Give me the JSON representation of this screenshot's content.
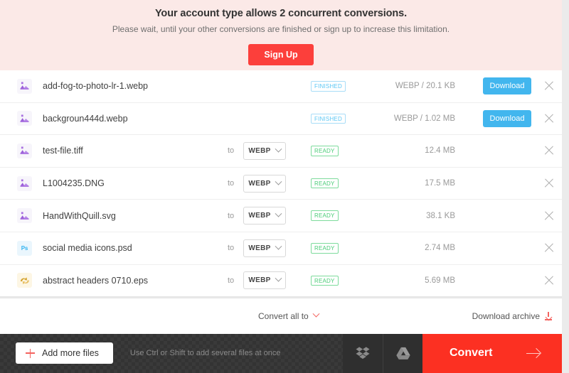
{
  "banner": {
    "title": "Your account type allows 2 concurrent conversions.",
    "subtitle": "Please wait, until your other conversions are finished or sign up to increase this limitation.",
    "signup_label": "Sign Up",
    "background_color": "#fbe9e7",
    "signup_color": "#fc3f3b"
  },
  "files": [
    {
      "name": "add-fog-to-photo-lr-1.webp",
      "icon": "image-file-icon",
      "to_label": "",
      "format": "",
      "status": "FINISHED",
      "status_type": "finished",
      "size": "WEBP / 20.1 KB",
      "download_label": "Download",
      "has_download": true,
      "has_format": false
    },
    {
      "name": "backgroun444d.webp",
      "icon": "image-file-icon",
      "to_label": "",
      "format": "",
      "status": "FINISHED",
      "status_type": "finished",
      "size": "WEBP / 1.02 MB",
      "download_label": "Download",
      "has_download": true,
      "has_format": false
    },
    {
      "name": "test-file.tiff",
      "icon": "image-file-icon",
      "to_label": "to",
      "format": "WEBP",
      "status": "READY",
      "status_type": "ready",
      "size": "12.4 MB",
      "download_label": "",
      "has_download": false,
      "has_format": true
    },
    {
      "name": "L1004235.DNG",
      "icon": "image-file-icon",
      "to_label": "to",
      "format": "WEBP",
      "status": "READY",
      "status_type": "ready",
      "size": "17.5 MB",
      "download_label": "",
      "has_download": false,
      "has_format": true
    },
    {
      "name": "HandWithQuill.svg",
      "icon": "image-file-icon",
      "to_label": "to",
      "format": "WEBP",
      "status": "READY",
      "status_type": "ready",
      "size": "38.1 KB",
      "download_label": "",
      "has_download": false,
      "has_format": true
    },
    {
      "name": "social media icons.psd",
      "icon": "photoshop-file-icon",
      "icon_text": "Ps",
      "to_label": "to",
      "format": "WEBP",
      "status": "READY",
      "status_type": "ready",
      "size": "2.74 MB",
      "download_label": "",
      "has_download": false,
      "has_format": true
    },
    {
      "name": "abstract headers 0710.eps",
      "icon": "eps-file-icon",
      "to_label": "to",
      "format": "WEBP",
      "status": "READY",
      "status_type": "ready",
      "size": "5.69 MB",
      "download_label": "",
      "has_download": false,
      "has_format": true
    }
  ],
  "subfooter": {
    "convert_all_label": "Convert all to",
    "download_archive_label": "Download archive"
  },
  "actionbar": {
    "add_files_label": "Add more files",
    "hint": "Use Ctrl or Shift to add several files at once",
    "convert_label": "Convert",
    "dropbox_name": "dropbox-icon",
    "gdrive_name": "google-drive-icon",
    "convert_color": "#fc3022"
  },
  "colors": {
    "finished_badge": "#5cc7f5",
    "ready_badge": "#49cc76",
    "download_button": "#42b6ee",
    "accent_red": "#f4635f"
  }
}
